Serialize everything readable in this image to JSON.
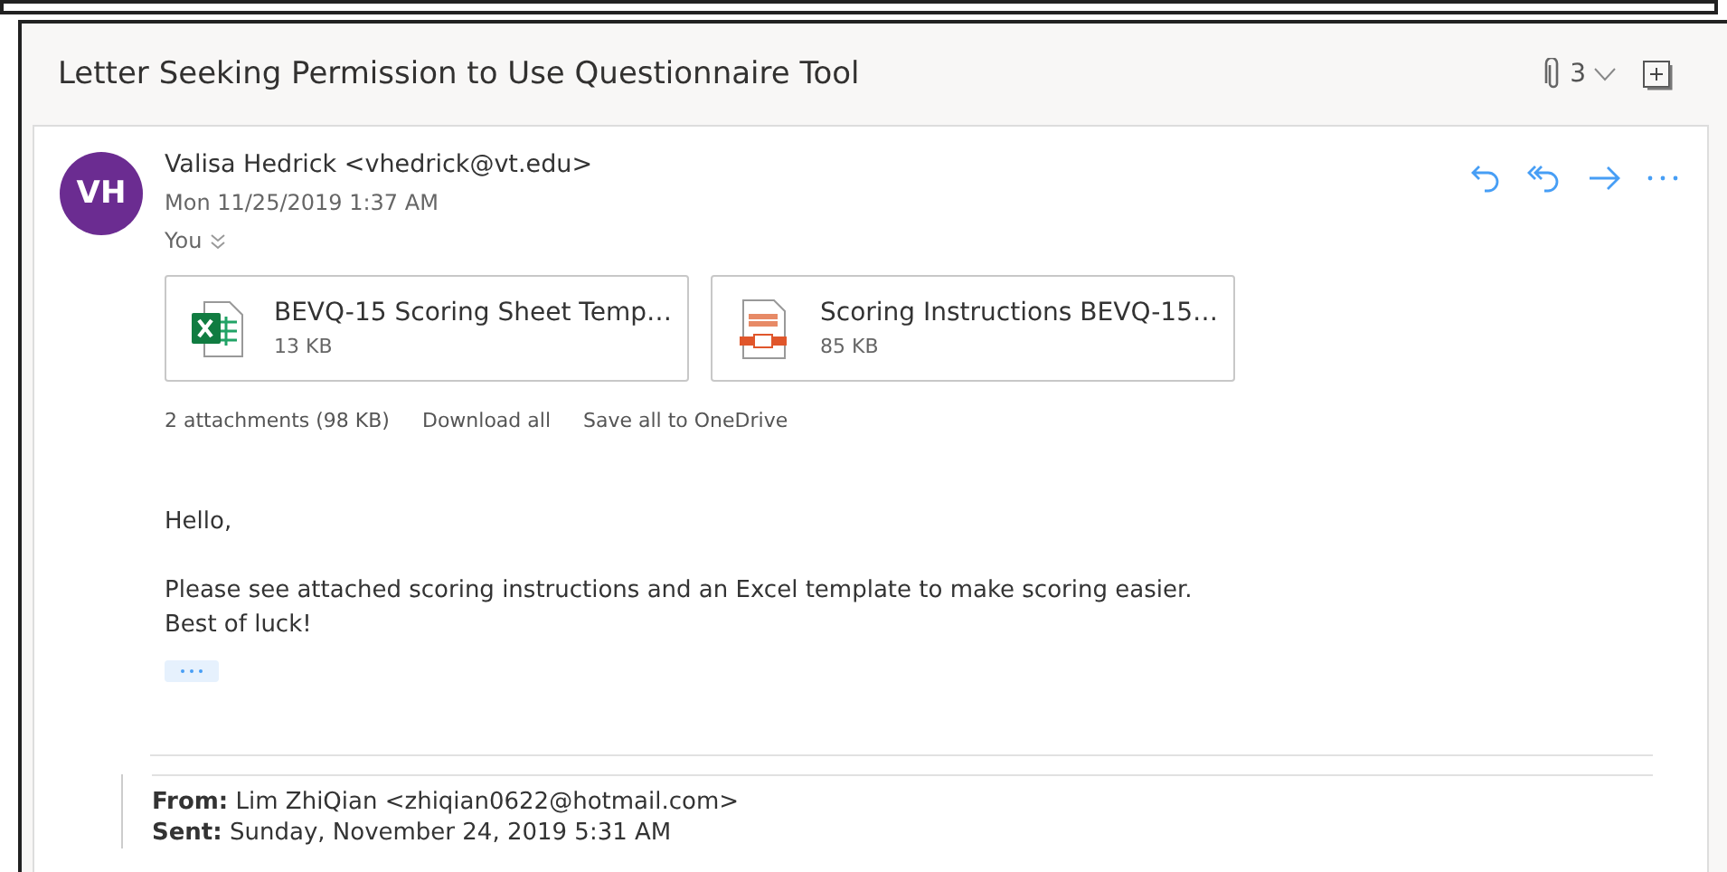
{
  "conversation": {
    "subject": "Letter Seeking Permission to Use Questionnaire Tool",
    "attachment_count": "3"
  },
  "message": {
    "avatar_initials": "VH",
    "sender": "Valisa Hedrick <vhedrick@vt.edu>",
    "date": "Mon 11/25/2019 1:37 AM",
    "recipients": "You",
    "attachments": [
      {
        "kind": "excel",
        "name": "BEVQ-15 Scoring Sheet Temp…",
        "size": "13 KB"
      },
      {
        "kind": "pdf",
        "name": "Scoring Instructions BEVQ-15…",
        "size": "85 KB"
      }
    ],
    "attachment_summary": "2 attachments (98 KB)",
    "attachment_actions": [
      "Download all",
      "Save all to OneDrive"
    ],
    "paragraphs": [
      [
        "Hello,"
      ],
      [
        "Please see attached scoring instructions and an Excel template to make scoring easier.",
        "Best of luck!"
      ]
    ],
    "quoted": [
      "**From:** Lim ZhiQian <zhiqian0622@hotmail.com>",
      "**Sent:** Sunday, November 24, 2019 5:31 AM"
    ]
  }
}
